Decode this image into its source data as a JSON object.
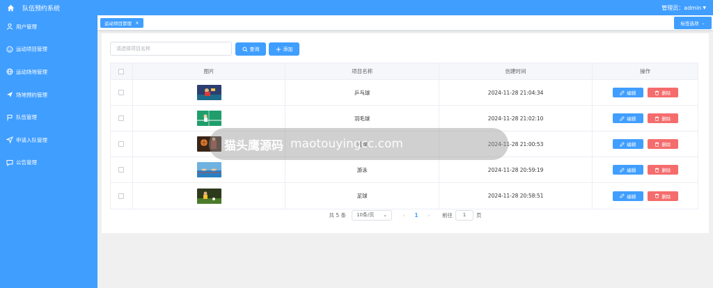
{
  "app": {
    "title": "队伍预约系统",
    "admin_label": "管理员：admin"
  },
  "sidebar": {
    "items": [
      {
        "label": "用户管理",
        "icon": "user-icon"
      },
      {
        "label": "运动项目管理",
        "icon": "smile-icon"
      },
      {
        "label": "运动场地管理",
        "icon": "globe-icon"
      },
      {
        "label": "场地预约管理",
        "icon": "send-icon"
      },
      {
        "label": "队伍管理",
        "icon": "flag-icon"
      },
      {
        "label": "申请入队管理",
        "icon": "location-icon"
      },
      {
        "label": "公告管理",
        "icon": "chat-icon"
      }
    ]
  },
  "tabs": {
    "active": "运动项目管理",
    "options_label": "标签选项"
  },
  "search": {
    "placeholder": "请选择项目名称",
    "value": "",
    "search_label": "查询",
    "add_label": "添加"
  },
  "table": {
    "headers": [
      "图片",
      "项目名称",
      "创建时间",
      "操作"
    ],
    "edit_label": "编辑",
    "delete_label": "删除",
    "rows": [
      {
        "name": "乒乓球",
        "time": "2024-11-28 21:04:34"
      },
      {
        "name": "羽毛球",
        "time": "2024-11-28 21:02:10"
      },
      {
        "name": "篮球",
        "time": "2024-11-28 21:00:53"
      },
      {
        "name": "游泳",
        "time": "2024-11-28 20:59:19"
      },
      {
        "name": "足球",
        "time": "2024-11-28 20:58:51"
      }
    ]
  },
  "pagination": {
    "total": "共 5 条",
    "page_size": "10条/页",
    "current": "1",
    "goto_label": "前往",
    "goto_value": "1",
    "page_suffix": "页"
  },
  "overlay": {
    "brand": "猫头鹰源码",
    "site": "maotouyingcc.com"
  },
  "colors": {
    "primary": "#409eff",
    "danger": "#f56c6c"
  }
}
